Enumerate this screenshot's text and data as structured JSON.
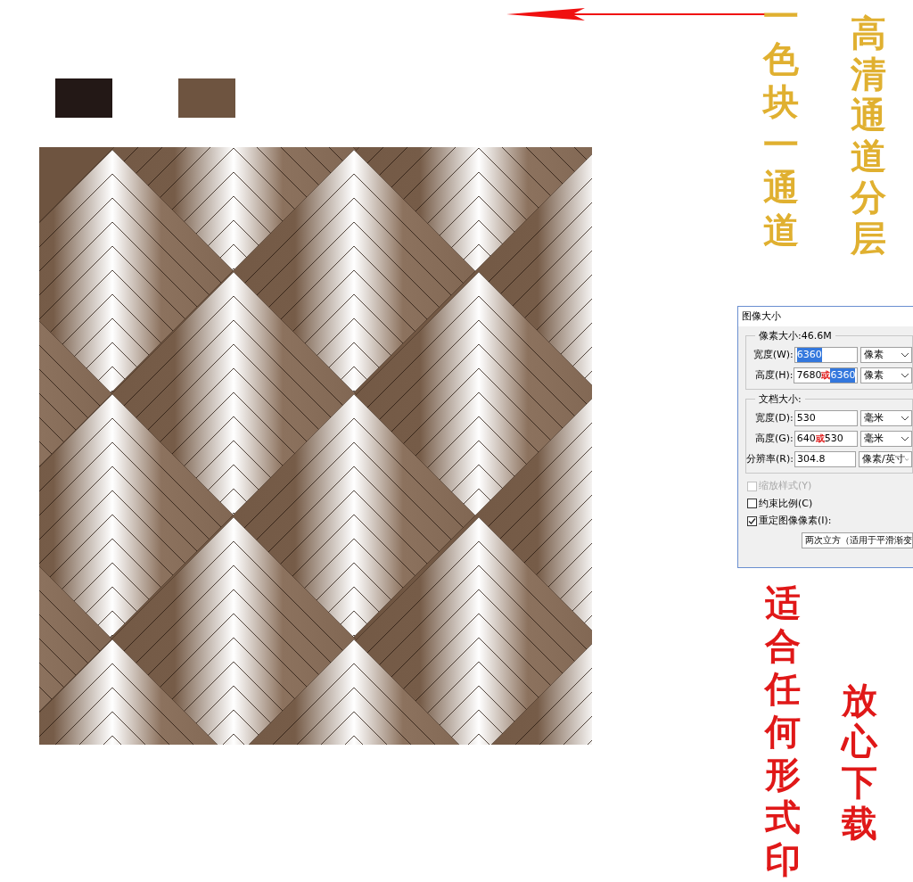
{
  "swatches": [
    {
      "color": "#231816"
    },
    {
      "color": "#6e5440"
    }
  ],
  "captions": [
    {
      "text": "一色块一通道",
      "kind": "gold"
    },
    {
      "text": "高清通道分层",
      "kind": "gold"
    },
    {
      "text": "适合任何形式印",
      "kind": "red"
    },
    {
      "text": "放心下载",
      "kind": "red"
    }
  ],
  "dialog": {
    "title": "图像大小",
    "pixel_group": {
      "legend": "像素大小:46.6M",
      "rows": [
        {
          "label": "宽度(W):",
          "value": [
            {
              "text": "6360",
              "kind": "selected"
            }
          ],
          "unit": "像素"
        },
        {
          "label": "高度(H):",
          "value": [
            {
              "text": "7680",
              "kind": "plain"
            },
            {
              "text": "或",
              "kind": "mark"
            },
            {
              "text": "6360",
              "kind": "selected"
            }
          ],
          "unit": "像素"
        }
      ]
    },
    "document_group": {
      "legend": "文档大小:",
      "rows": [
        {
          "label": "宽度(D):",
          "value": [
            {
              "text": "530",
              "kind": "plain"
            }
          ],
          "unit": "毫米"
        },
        {
          "label": "高度(G):",
          "value": [
            {
              "text": "640 ",
              "kind": "plain"
            },
            {
              "text": "或",
              "kind": "mark"
            },
            {
              "text": " 530",
              "kind": "plain"
            }
          ],
          "unit": "毫米"
        },
        {
          "label": "分辨率(R):",
          "value": [
            {
              "text": "304.8",
              "kind": "plain"
            }
          ],
          "unit": "像素/英寸"
        }
      ]
    },
    "checkboxes": [
      {
        "label": "缩放样式(Y)",
        "checked": false,
        "disabled": true
      },
      {
        "label": "约束比例(C)",
        "checked": false,
        "disabled": false
      },
      {
        "label": "重定图像像素(I):",
        "checked": true,
        "disabled": false
      }
    ],
    "resample": "两次立方（适用于平滑渐变"
  }
}
